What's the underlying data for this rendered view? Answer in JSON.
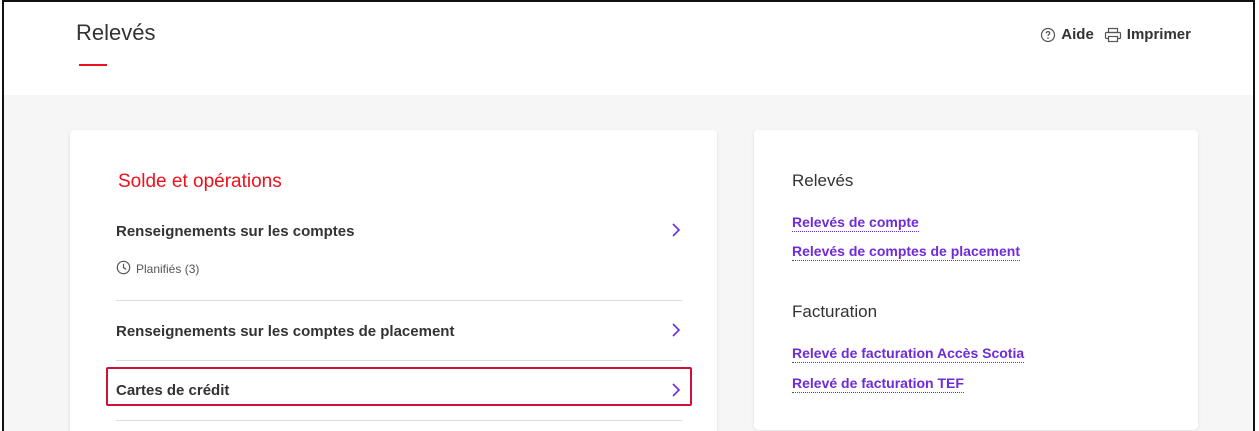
{
  "header": {
    "title": "Relevés",
    "help_label": "Aide",
    "print_label": "Imprimer",
    "accent_color": "#ec111a"
  },
  "left_card": {
    "section_title": "Solde et opérations",
    "items": [
      {
        "label": "Renseignements sur les comptes",
        "sub_label": "Planifiés (3)",
        "sub_icon": "clock-icon",
        "icon": "chevron-right-icon"
      },
      {
        "label": "Renseignements sur les comptes de placement",
        "icon": "chevron-right-icon"
      },
      {
        "label": "Cartes de crédit",
        "icon": "chevron-right-icon",
        "highlighted": true
      }
    ]
  },
  "right_card": {
    "statements_title": "Relevés",
    "statements_links": [
      "Relevés de compte",
      "Relevés de comptes de placement"
    ],
    "billing_title": "Facturation",
    "billing_links": [
      "Relevé de facturation Accès Scotia",
      "Relevé de facturation TEF"
    ],
    "link_color": "#6f2bd9"
  }
}
